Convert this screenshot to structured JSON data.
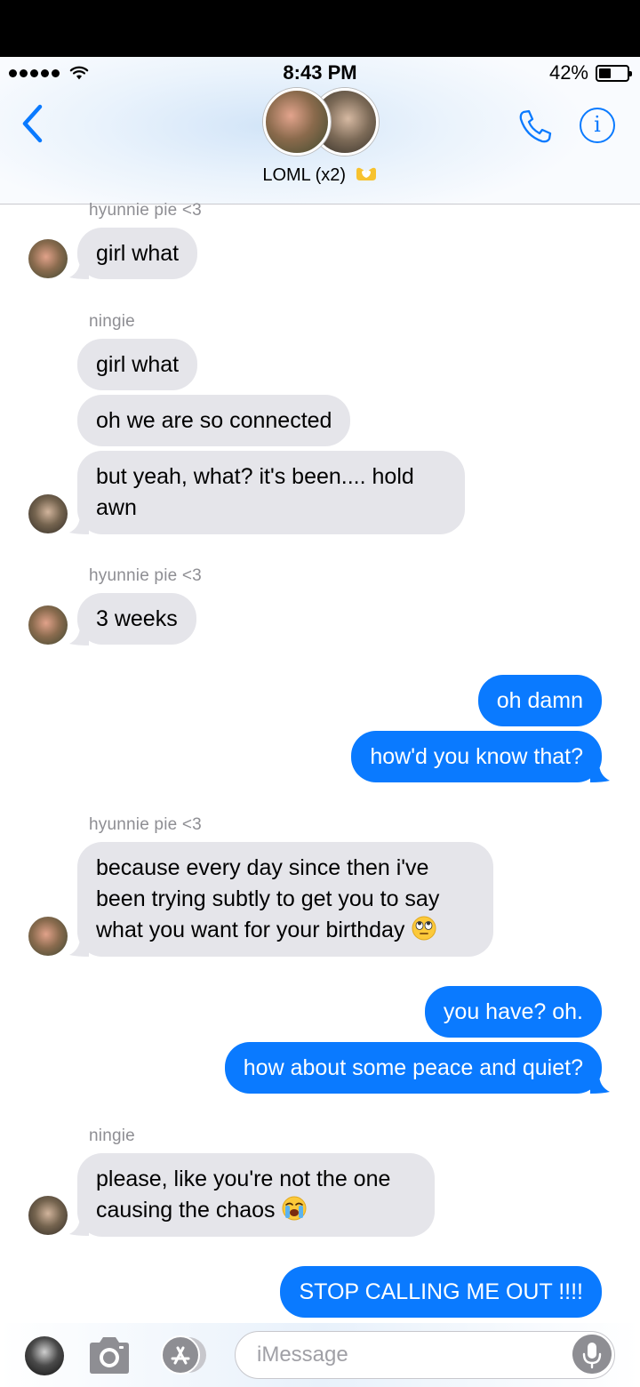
{
  "status_bar": {
    "time": "8:43 PM",
    "battery": "42%"
  },
  "header": {
    "title": "LOML (x2)"
  },
  "messages": [
    {
      "sender": "hyunnie pie <3",
      "text": "girl what"
    },
    {
      "sender": "ningie",
      "text": "girl what"
    },
    {
      "text": "oh we are so connected"
    },
    {
      "text_line1": "but yeah, what? it's been.... hold",
      "text_line2": "awn"
    },
    {
      "sender": "hyunnie pie <3",
      "text": "3 weeks"
    },
    {
      "text": "oh damn"
    },
    {
      "text": "how'd you know that?"
    },
    {
      "sender": "hyunnie pie <3",
      "text_line1": "because every day since then i've",
      "text_line2": "been trying subtly to get you to say",
      "text_line3": "what you want for your birthday"
    },
    {
      "text": "you have? oh."
    },
    {
      "text": "how about some peace and quiet?"
    },
    {
      "sender": "ningie",
      "text_line1": "please, like you're not the one",
      "text_line2": "causing the chaos"
    },
    {
      "text": "STOP CALLING ME OUT !!!!"
    }
  ],
  "input": {
    "placeholder": "iMessage"
  },
  "colors": {
    "accent": "#0a7aff",
    "incoming": "#e5e5ea",
    "secondary_text": "#8e8e93"
  },
  "icons": [
    "signal-dots-icon",
    "wifi-icon",
    "battery-icon",
    "back-chevron-icon",
    "heart-hands-emoji-icon",
    "phone-icon",
    "info-icon",
    "rolling-eyes-emoji-icon",
    "crying-emoji-icon",
    "camera-icon",
    "app-store-icon",
    "microphone-icon"
  ]
}
